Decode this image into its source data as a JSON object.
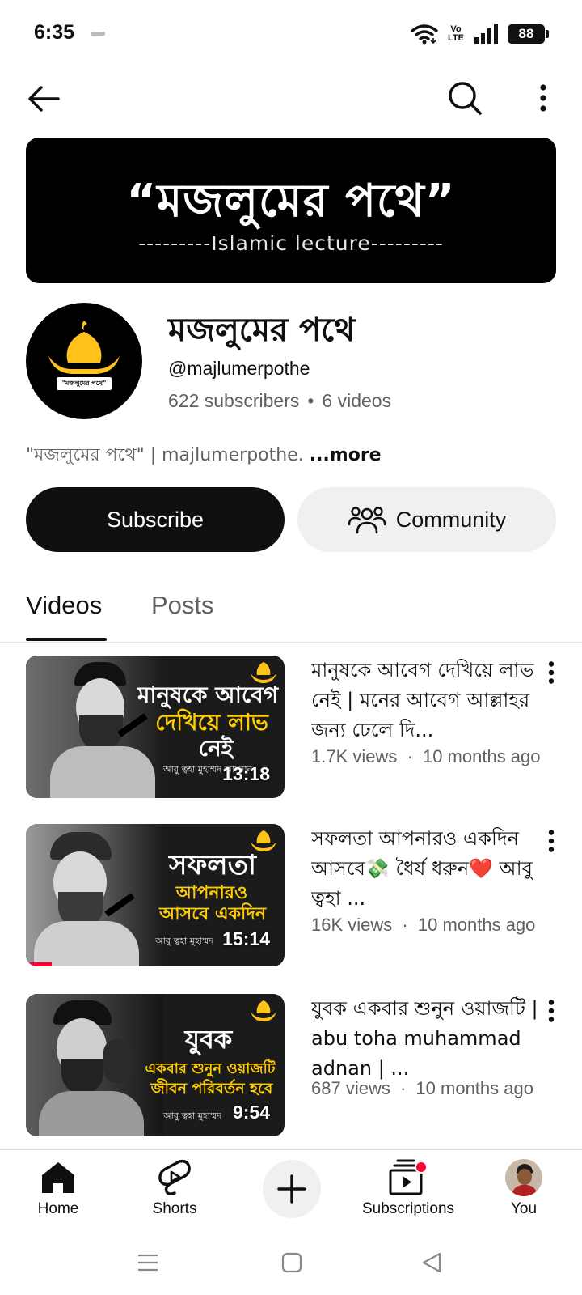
{
  "status_bar": {
    "time": "6:35",
    "volte_line1": "Vo",
    "volte_line2": "LTE",
    "battery": "88"
  },
  "header": {
    "back_icon": "arrow-left-icon",
    "search_icon": "search-icon",
    "more_icon": "more-vertical-icon"
  },
  "banner": {
    "title": "“মজলুমের পথে”",
    "subtitle": "---------Islamic lecture---------"
  },
  "channel": {
    "name": "মজলুমের পথে",
    "handle": "@majlumerpothe",
    "subscribers": "622 subscribers",
    "videos_count": "6 videos",
    "separator": "•",
    "description": "\"মজলুমের পথে\" | majlumerpothe.",
    "more_label": "...more",
    "avatar_label": "\"মজলুমের পথে\""
  },
  "actions": {
    "subscribe_label": "Subscribe",
    "community_label": "Community"
  },
  "tabs": [
    {
      "label": "Videos",
      "active": true
    },
    {
      "label": "Posts",
      "active": false
    }
  ],
  "videos": [
    {
      "title": "মানুষকে আবেগ দেখিয়ে লাভ নেই | মনের আবেগ আল্লাহর জন্য ঢেলে দি...",
      "views": "1.7K views",
      "age": "10 months ago",
      "duration": "13:18",
      "thumb_line1": "মানুষকে আবেগ",
      "thumb_line2": "দেখিয়ে লাভ",
      "thumb_line3": "নেই",
      "thumb_credit": "আবু ত্বহা মুহাম্মদ আদনান"
    },
    {
      "title": "সফলতা আপনারও একদিন আসবে💸 ধৈর্য ধরুন❤️ আবু ত্বহা ...",
      "views": "16K views",
      "age": "10 months ago",
      "duration": "15:14",
      "thumb_line1": "সফলতা",
      "thumb_line2": "আপনারও",
      "thumb_line3": "আসবে একদিন",
      "thumb_credit": "আবু ত্বহা মুহাম্মদ",
      "watch_progress": 0.1
    },
    {
      "title": "যুবক একবার শুনুন ওয়াজটি | abu toha muhammad adnan | ...",
      "views": "687 views",
      "age": "10 months ago",
      "duration": "9:54",
      "thumb_line1": "যুবক",
      "thumb_line2": "একবার শুনুন ওয়াজটি",
      "thumb_line3": "জীবন পরিবর্তন হবে",
      "thumb_credit": "আবু ত্বহা মুহাম্মদ"
    }
  ],
  "meta_separator": "·",
  "bottom_nav": {
    "home": "Home",
    "shorts": "Shorts",
    "subscriptions": "Subscriptions",
    "you": "You"
  },
  "colors": {
    "primary_text": "#0f0f0f",
    "secondary_text": "#606060",
    "accent_red": "#ff0033",
    "banner_bg": "#000000",
    "thumb_yellow": "#ffcc00",
    "thumb_orange": "#ff9d00"
  }
}
